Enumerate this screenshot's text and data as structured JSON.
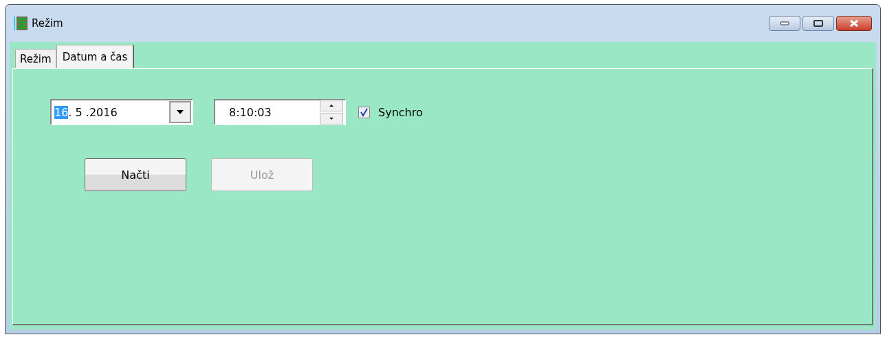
{
  "window": {
    "title": "Režim"
  },
  "tabs": [
    {
      "label": "Režim",
      "selected": false
    },
    {
      "label": "Datum a čas",
      "selected": true
    }
  ],
  "date_field": {
    "segments": [
      {
        "text": "16",
        "selected": true
      },
      {
        "text": ". 5 .2016",
        "selected": false
      }
    ]
  },
  "time_field": {
    "value": "8:10:03"
  },
  "synchro": {
    "label": "Synchro",
    "checked": true
  },
  "buttons": [
    {
      "label": "Načti",
      "disabled": false
    },
    {
      "label": "Ulož",
      "disabled": true
    }
  ]
}
